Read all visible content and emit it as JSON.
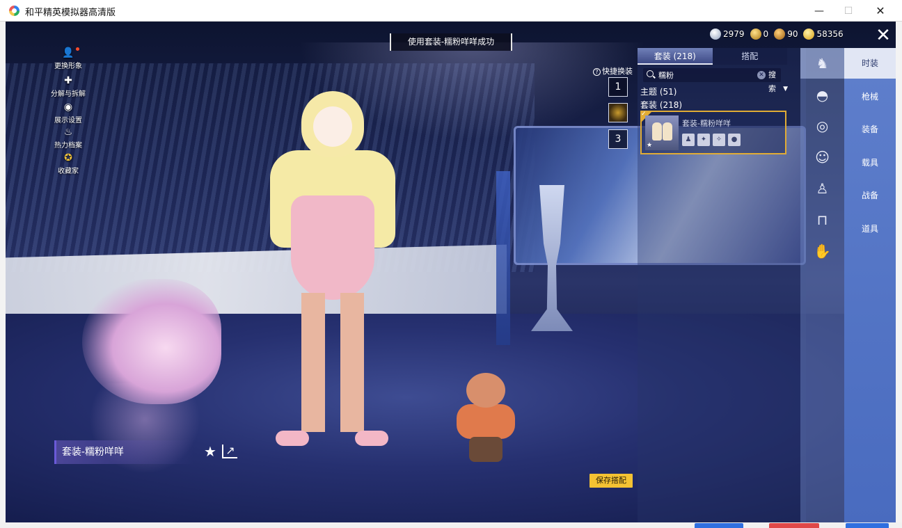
{
  "window": {
    "title": "和平精英模拟器高清版",
    "minimize": "—",
    "maximize": "☐",
    "close": "✕"
  },
  "left_menu": [
    {
      "label": "更换形象",
      "icon": "person-icon"
    },
    {
      "label": "分解与拆解",
      "icon": "puzzle-icon"
    },
    {
      "label": "展示设置",
      "icon": "eye-icon"
    },
    {
      "label": "热力档案",
      "icon": "flame-icon"
    },
    {
      "label": "收藏家",
      "icon": "collector-badge-icon"
    }
  ],
  "toast": "使用套装-糯粉咩咩成功",
  "currencies": [
    {
      "name": "silver",
      "value": "2979",
      "color": "#8f9fbc"
    },
    {
      "name": "bronze",
      "value": "0",
      "color": "#a77512"
    },
    {
      "name": "gold",
      "value": "90",
      "color": "#9b5d10"
    },
    {
      "name": "points",
      "value": "58356",
      "color": "#d79d12"
    }
  ],
  "panel": {
    "tabs": [
      "套装 (218)",
      "搭配"
    ],
    "active_tab": 0,
    "search": {
      "value": "糯粉",
      "button": "搜索"
    },
    "filters": {
      "themes": "主题 (51)",
      "outfits": "套装 (218)"
    },
    "result": {
      "name": "套装-糯粉咩咩",
      "selected": true
    },
    "quick_switch": {
      "label": "快捷换装",
      "slots": [
        "1",
        "",
        "3"
      ]
    }
  },
  "categories": [
    "outfit-icon",
    "hat-icon",
    "glasses-icon",
    "face-icon",
    "top-icon",
    "pants-icon",
    "emote-icon"
  ],
  "nav": {
    "items": [
      "时装",
      "枪械",
      "装备",
      "载具",
      "战备",
      "道具"
    ],
    "active": 0
  },
  "bottom": {
    "outfit_name": "套装-糯粉咩咩",
    "save_label": "保存搭配"
  },
  "colors": {
    "accent_gold": "#f4c233",
    "nav_blue": "#5f7fcc",
    "selected_border": "#e1ac35"
  }
}
